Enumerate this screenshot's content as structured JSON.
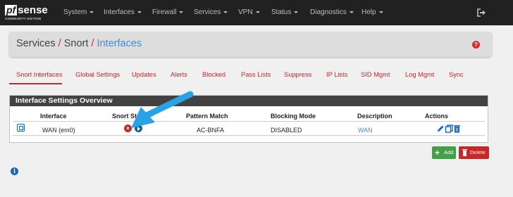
{
  "logo": {
    "main_pf": "pf",
    "main_sense": "sense",
    "sub": "COMMUNITY EDITION"
  },
  "nav": {
    "items": [
      {
        "label": "System"
      },
      {
        "label": "Interfaces"
      },
      {
        "label": "Firewall"
      },
      {
        "label": "Services"
      },
      {
        "label": "VPN"
      },
      {
        "label": "Status"
      },
      {
        "label": "Diagnostics"
      },
      {
        "label": "Help"
      }
    ]
  },
  "breadcrumb": {
    "part1": "Services",
    "sep": "/",
    "part2": "Snort",
    "part3": "Interfaces"
  },
  "help_icon": "?",
  "tabs": [
    {
      "label": "Snort Interfaces"
    },
    {
      "label": "Global Settings"
    },
    {
      "label": "Updates"
    },
    {
      "label": "Alerts"
    },
    {
      "label": "Blocked"
    },
    {
      "label": "Pass Lists"
    },
    {
      "label": "Suppress"
    },
    {
      "label": "IP Lists"
    },
    {
      "label": "SID Mgmt"
    },
    {
      "label": "Log Mgmt"
    },
    {
      "label": "Sync"
    }
  ],
  "panel": {
    "title": "Interface Settings Overview",
    "columns": [
      "Interface",
      "Snort Status",
      "Pattern Match",
      "Blocking Mode",
      "Description",
      "Actions"
    ],
    "rows": [
      {
        "interface": "WAN (em0)",
        "pattern": "AC-BNFA",
        "blocking": "DISABLED",
        "description": "WAN"
      }
    ]
  },
  "buttons": {
    "add": "Add",
    "delete": "Delete"
  },
  "colors": {
    "accent_red": "#c62828",
    "link_blue": "#3f8dd8",
    "navbar": "#212121",
    "arrow": "#29a3e6"
  }
}
